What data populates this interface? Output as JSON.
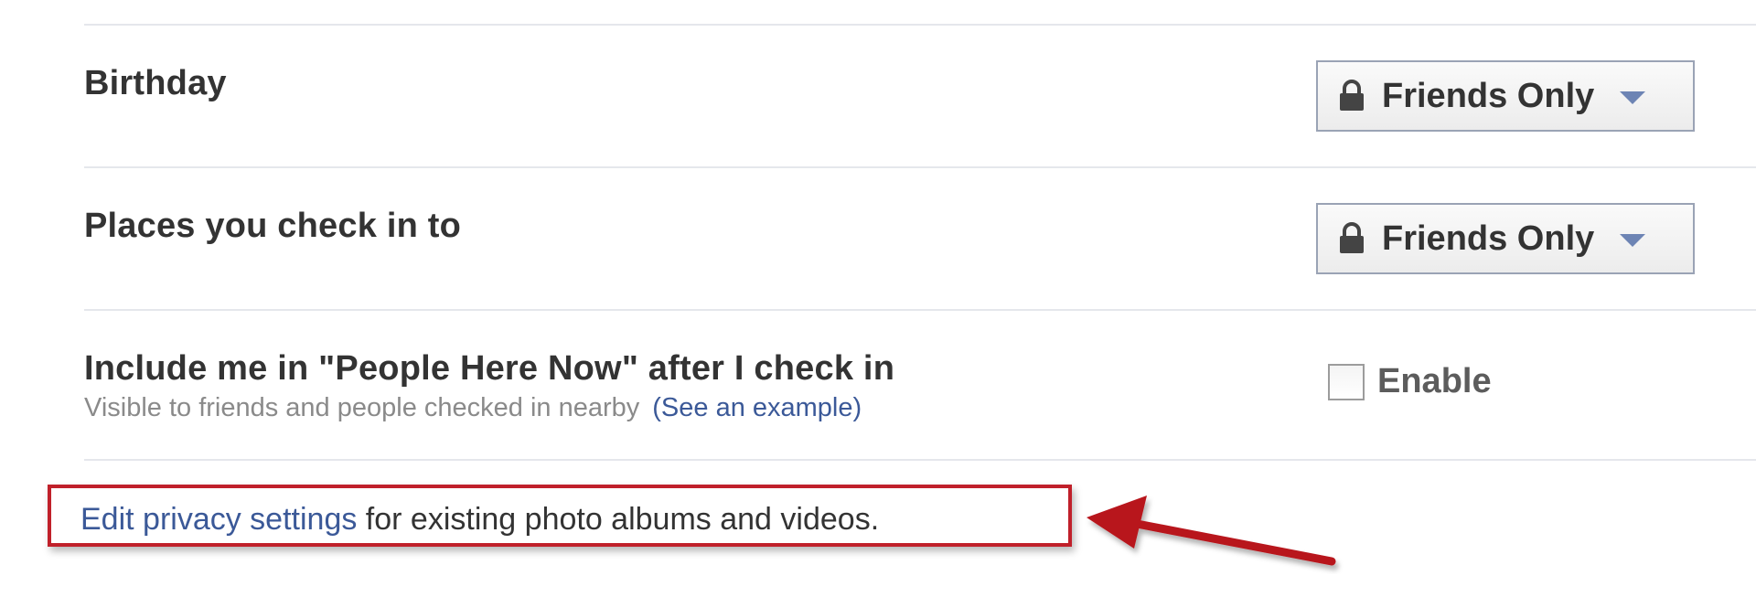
{
  "rows": [
    {
      "label": "Birthday",
      "control": "dropdown",
      "value": "Friends Only",
      "icon": "lock-icon"
    },
    {
      "label": "Places you check in to",
      "control": "dropdown",
      "value": "Friends Only",
      "icon": "lock-icon"
    },
    {
      "label": "Include me in \"People Here Now\" after I check in",
      "sublabel": "Visible to friends and people checked in nearby",
      "sublink": "(See an example)",
      "control": "checkbox",
      "checkbox_label": "Enable",
      "checked": false
    }
  ],
  "footer": {
    "link_text": "Edit privacy settings",
    "rest_text": " for existing photo albums and videos."
  },
  "annotation": {
    "highlight_color": "#c0202a",
    "arrow_color": "#b8141c",
    "arrow_icon": "arrow-left-icon"
  },
  "colors": {
    "link": "#3b5998",
    "text": "#333333",
    "subtext": "#8a8a8a",
    "separator": "#e5e7ec",
    "caret": "#6d84b4"
  }
}
